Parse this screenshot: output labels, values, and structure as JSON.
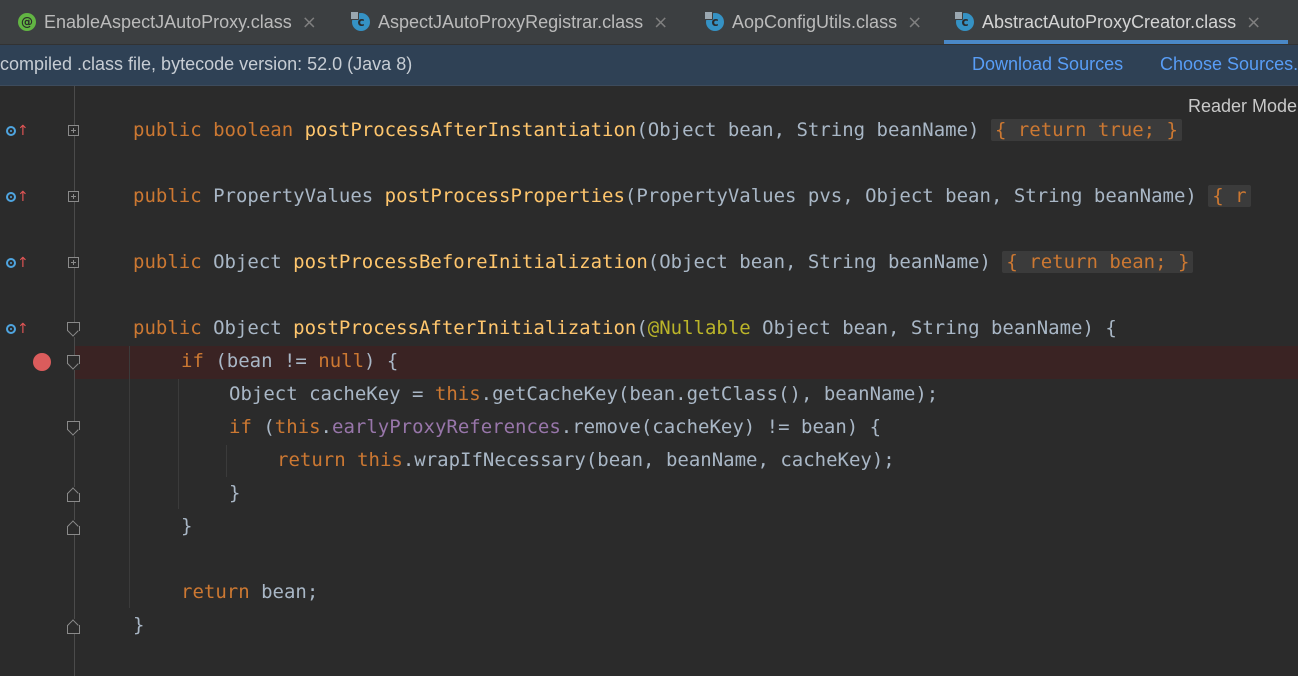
{
  "tabs": [
    {
      "label": "EnableAspectJAutoProxy.class",
      "icon": "annotation-icon",
      "active": false
    },
    {
      "label": "AspectJAutoProxyRegistrar.class",
      "icon": "class-icon",
      "active": false
    },
    {
      "label": "AopConfigUtils.class",
      "icon": "class-icon",
      "active": false
    },
    {
      "label": "AbstractAutoProxyCreator.class",
      "icon": "class-icon",
      "active": true
    }
  ],
  "tab_close_glyph": "×",
  "banner": {
    "message": "compiled .class file, bytecode version: 52.0 (Java 8)",
    "download_sources": "Download Sources",
    "choose_sources": "Choose Sources..."
  },
  "editor": {
    "reader_mode": "Reader Mode",
    "colors": {
      "keyword": "#cc7832",
      "method": "#ffc66d",
      "field": "#9876aa",
      "annotation": "#bbb529",
      "text": "#a9b7c6",
      "breakpoint": "#db5c5c"
    },
    "code": {
      "l1": {
        "kw": "public boolean ",
        "fn": "postProcessAfterInstantiation",
        "args": "(Object bean, String beanName) ",
        "fold": "{ return true; }"
      },
      "l2": {
        "kw": "public ",
        "type": "PropertyValues ",
        "fn": "postProcessProperties",
        "args": "(PropertyValues pvs, Object bean, String beanName) ",
        "fold": "{ r"
      },
      "l3": {
        "kw": "public ",
        "type": "Object ",
        "fn": "postProcessBeforeInitialization",
        "args": "(Object bean, String beanName) ",
        "fold": "{ return bean; }"
      },
      "l4": {
        "kw": "public ",
        "type": "Object ",
        "fn": "postProcessAfterInitialization",
        "open": "(",
        "ann": "@Nullable",
        "args": " Object bean, String beanName) {"
      },
      "l5": {
        "kw": "if ",
        "rest": "(bean != ",
        "kw2": "null",
        "end": ") {"
      },
      "l6": {
        "text": "Object cacheKey = ",
        "kw": "this",
        "rest": ".getCacheKey(bean.getClass(), beanName);"
      },
      "l7": {
        "kw": "if ",
        "open": "(",
        "kw2": "this",
        "dot": ".",
        "field": "earlyProxyReferences",
        "rest": ".remove(cacheKey) != bean) {"
      },
      "l8": {
        "kw": "return ",
        "kw2": "this",
        "rest": ".wrapIfNecessary(bean, beanName, cacheKey);"
      },
      "l9": "}",
      "l10": "}",
      "l11": {
        "kw": "return ",
        "rest": "bean;"
      },
      "l12": "}"
    }
  }
}
